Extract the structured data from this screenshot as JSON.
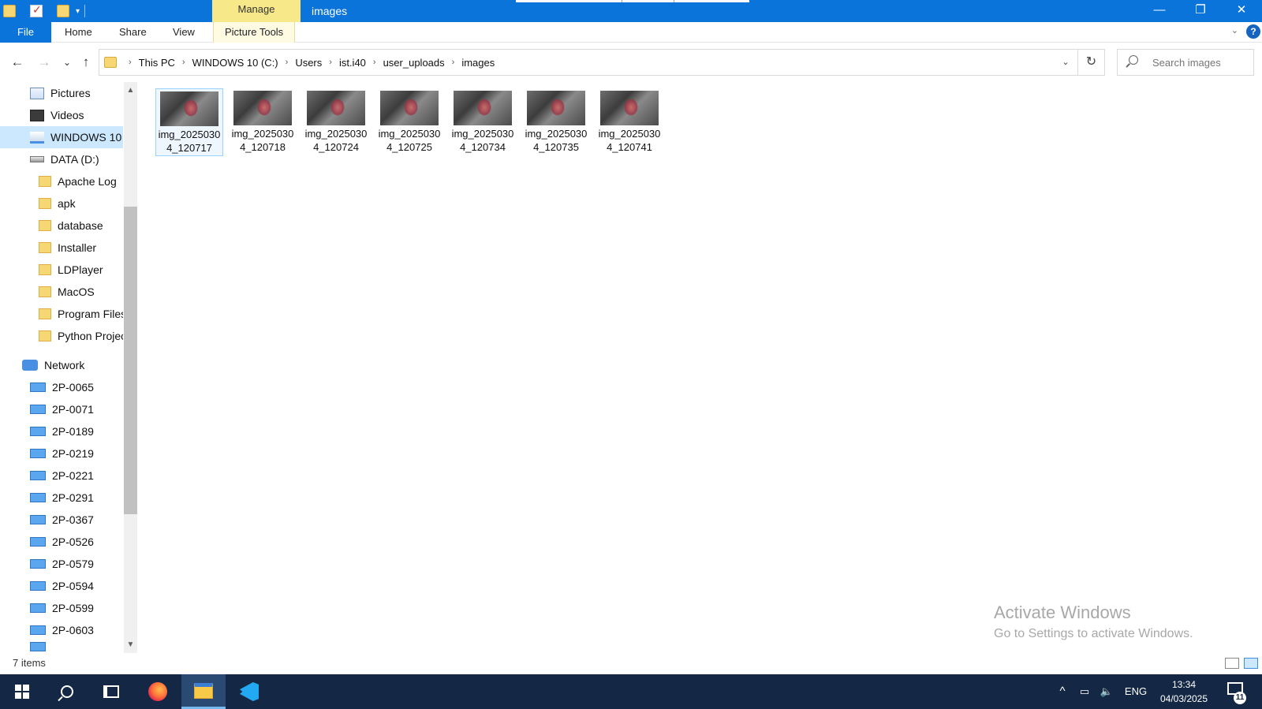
{
  "window": {
    "title": "images",
    "context_tab": "Manage",
    "controls": {
      "minimize": "—",
      "restore": "❐",
      "close": "✕"
    }
  },
  "ribbon": {
    "tabs": [
      "File",
      "Home",
      "Share",
      "View",
      "Picture Tools"
    ],
    "collapse": "⌄",
    "help": "?"
  },
  "nav": {
    "back": "←",
    "forward": "→",
    "recent": "⌄",
    "up": "↑"
  },
  "address": {
    "crumbs": [
      "This PC",
      "WINDOWS 10 (C:)",
      "Users",
      "ist.i40",
      "user_uploads",
      "images"
    ],
    "separator": "›",
    "dropdown": "⌄",
    "refresh": "↻"
  },
  "search": {
    "placeholder": "Search images"
  },
  "sidebar": {
    "items": [
      {
        "label": "Pictures",
        "icon": "pictures-icon"
      },
      {
        "label": "Videos",
        "icon": "videos-icon"
      },
      {
        "label": "WINDOWS 10 (",
        "icon": "drive-c-icon",
        "selected": true
      },
      {
        "label": "DATA (D:)",
        "icon": "drive-icon"
      },
      {
        "label": "Apache Log",
        "icon": "folder-icon"
      },
      {
        "label": "apk",
        "icon": "folder-icon"
      },
      {
        "label": "database",
        "icon": "folder-icon"
      },
      {
        "label": "Installer",
        "icon": "folder-icon"
      },
      {
        "label": "LDPlayer",
        "icon": "folder-icon"
      },
      {
        "label": "MacOS",
        "icon": "folder-icon"
      },
      {
        "label": "Program Files",
        "icon": "folder-icon"
      },
      {
        "label": "Python Projec",
        "icon": "folder-icon"
      },
      {
        "label": "Network",
        "icon": "network-icon"
      },
      {
        "label": "2P-0065",
        "icon": "computer-icon"
      },
      {
        "label": "2P-0071",
        "icon": "computer-icon"
      },
      {
        "label": "2P-0189",
        "icon": "computer-icon"
      },
      {
        "label": "2P-0219",
        "icon": "computer-icon"
      },
      {
        "label": "2P-0221",
        "icon": "computer-icon"
      },
      {
        "label": "2P-0291",
        "icon": "computer-icon"
      },
      {
        "label": "2P-0367",
        "icon": "computer-icon"
      },
      {
        "label": "2P-0526",
        "icon": "computer-icon"
      },
      {
        "label": "2P-0579",
        "icon": "computer-icon"
      },
      {
        "label": "2P-0594",
        "icon": "computer-icon"
      },
      {
        "label": "2P-0599",
        "icon": "computer-icon"
      },
      {
        "label": "2P-0603",
        "icon": "computer-icon"
      }
    ],
    "scroll_up": "▲",
    "scroll_down": "▼"
  },
  "files": [
    {
      "name": "img_20250304_120717",
      "selected": true
    },
    {
      "name": "img_20250304_120718"
    },
    {
      "name": "img_20250304_120724"
    },
    {
      "name": "img_20250304_120725"
    },
    {
      "name": "img_20250304_120734"
    },
    {
      "name": "img_20250304_120735"
    },
    {
      "name": "img_20250304_120741"
    }
  ],
  "watermark": {
    "line1": "Activate Windows",
    "line2": "Go to Settings to activate Windows."
  },
  "status": {
    "count": "7 items"
  },
  "taskbar": {
    "tray": {
      "chevron": "^",
      "language": "ENG"
    },
    "clock": {
      "time": "13:34",
      "date": "04/03/2025"
    },
    "notifications": "11"
  }
}
